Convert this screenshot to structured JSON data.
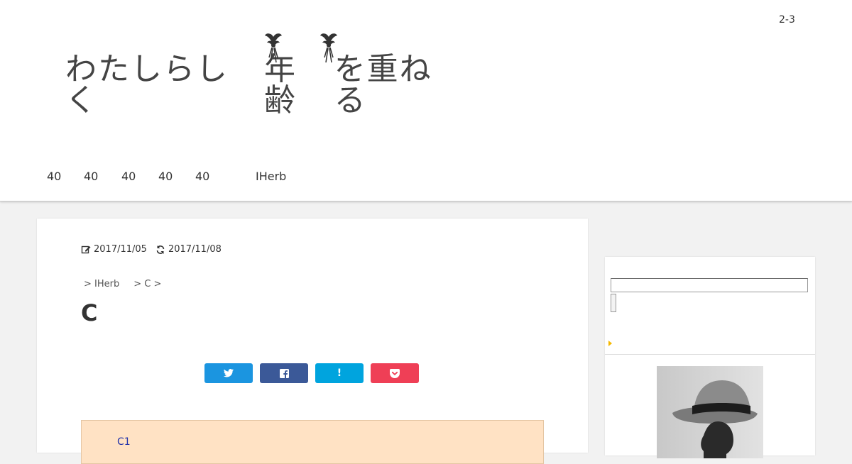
{
  "header": {
    "top_link": "2-3",
    "logo": {
      "part1": "わたしらしく",
      "part2": "年齢",
      "part3": "を重ねる"
    },
    "nav": [
      "40",
      "40",
      "40",
      "40",
      "40",
      "IHerb"
    ]
  },
  "article": {
    "posted_date": "2017/11/05",
    "updated_date": "2017/11/08",
    "breadcrumb": [
      "> IHerb",
      "> C >"
    ],
    "title": "C",
    "share_buttons": [
      {
        "icon": "twitter-icon",
        "label": "",
        "color": "#1b95e0"
      },
      {
        "icon": "facebook-icon",
        "label": "",
        "color": "#3b5998"
      },
      {
        "icon": "hatena-icon",
        "label": "!",
        "color": "#00a4de"
      },
      {
        "icon": "pocket-icon",
        "label": "",
        "color": "#ef3f56"
      }
    ],
    "toc_label": "C1"
  },
  "colors": {
    "toc_background": "#ffe2c4",
    "toc_text": "#2233aa",
    "arrow": "#f5b800"
  }
}
